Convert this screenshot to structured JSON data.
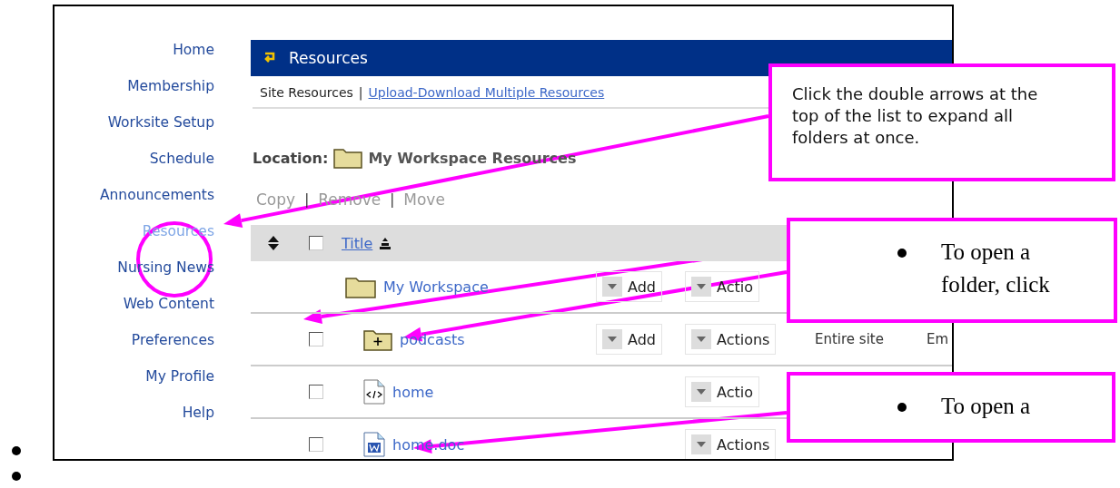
{
  "sidebar": {
    "items": [
      {
        "label": "Home",
        "selected": false
      },
      {
        "label": "Membership",
        "selected": false
      },
      {
        "label": "Worksite Setup",
        "selected": false
      },
      {
        "label": "Schedule",
        "selected": false
      },
      {
        "label": "Announcements",
        "selected": false
      },
      {
        "label": "Resources",
        "selected": true
      },
      {
        "label": "Nursing News",
        "selected": false
      },
      {
        "label": "Web Content",
        "selected": false
      },
      {
        "label": "Preferences",
        "selected": false
      },
      {
        "label": "My Profile",
        "selected": false
      },
      {
        "label": "Help",
        "selected": false
      }
    ]
  },
  "tool": {
    "title": "Resources",
    "subnav": {
      "current": "Site Resources",
      "separator": "|",
      "link": "Upload-Download Multiple Resources"
    },
    "location": {
      "label": "Location:",
      "path": "My Workspace Resources"
    },
    "actions": [
      {
        "label": "Copy",
        "disabled": true
      },
      {
        "label": "Remove",
        "disabled": true
      },
      {
        "label": "Move",
        "disabled": true
      }
    ],
    "action_separator": "|",
    "table": {
      "header": {
        "title": "Title",
        "checked": false
      },
      "rows": [
        {
          "kind": "root_folder",
          "title": "My Workspace",
          "add": "Add",
          "actions": "Actio"
        },
        {
          "kind": "folder",
          "title": "podcasts",
          "checked": false,
          "add": "Add",
          "actions": "Actions",
          "access": "Entire site",
          "column_5": "Em"
        },
        {
          "kind": "html",
          "title": "home",
          "checked": false,
          "actions": "Actio"
        },
        {
          "kind": "doc",
          "title": "home.doc",
          "checked": false,
          "actions": "Actions"
        }
      ]
    }
  },
  "callouts": [
    {
      "kind": "plain",
      "text": "Click the double arrows at the top of the list to expand all folders at once."
    },
    {
      "kind": "bullet",
      "text": "To open a folder, click"
    },
    {
      "kind": "bullet",
      "text": "To open a"
    }
  ],
  "document_list": [
    {
      "kind": "bullet"
    },
    {
      "kind": "bullet"
    }
  ]
}
